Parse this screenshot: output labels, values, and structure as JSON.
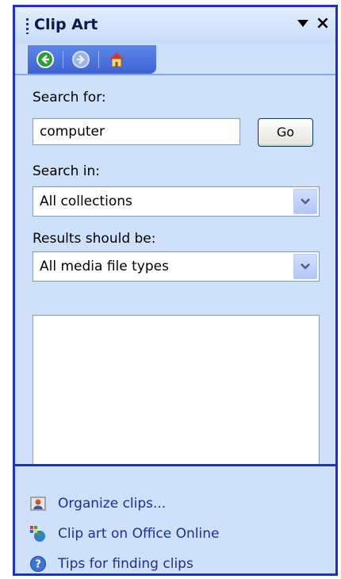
{
  "pane": {
    "title": "Clip Art"
  },
  "nav": {
    "back_icon": "back-arrow-icon",
    "forward_icon": "forward-arrow-icon",
    "home_icon": "home-icon"
  },
  "search": {
    "label": "Search for:",
    "value": "computer",
    "go_label": "Go"
  },
  "search_in": {
    "label": "Search in:",
    "selected": "All collections"
  },
  "results_type": {
    "label": "Results should be:",
    "selected": "All media file types"
  },
  "links": [
    {
      "label": "Organize clips...",
      "icon": "organize-clips-icon"
    },
    {
      "label": "Clip art on Office Online",
      "icon": "office-online-icon"
    },
    {
      "label": "Tips for finding clips",
      "icon": "help-icon"
    }
  ]
}
